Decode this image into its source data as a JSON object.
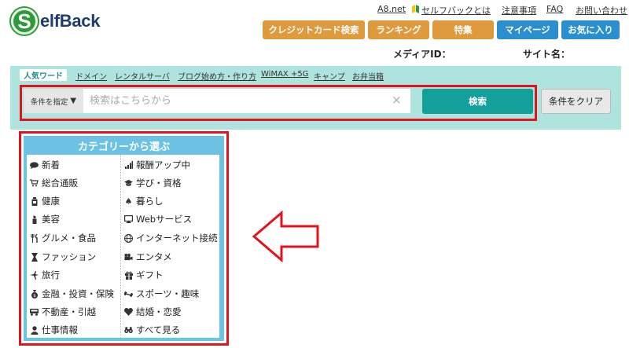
{
  "logo": {
    "mark": "S",
    "text": "elfBack"
  },
  "top_links": [
    {
      "label": "A8.net",
      "icon": ""
    },
    {
      "label": "セルフバックとは",
      "icon": "beginner-leaf-icon"
    },
    {
      "label": "注意事項",
      "icon": ""
    },
    {
      "label": "FAQ",
      "icon": ""
    },
    {
      "label": "お問い合わせ",
      "icon": ""
    }
  ],
  "nav": [
    {
      "label": "クレジットカード検索",
      "color": "#e09a3e"
    },
    {
      "label": "ランキング",
      "color": "#e09a3e"
    },
    {
      "label": "特集",
      "color": "#e09a3e"
    },
    {
      "label": "マイページ",
      "color": "#2b8fcf"
    },
    {
      "label": "お気に入り",
      "color": "#2b8fcf"
    }
  ],
  "meta": {
    "media_id": "メディアID：",
    "site_name": "サイト名："
  },
  "popular": {
    "label": "人気ワード",
    "words": [
      "ドメイン",
      "レンタルサーバ",
      "ブログ始め方・作り方",
      "WiMAX +5G",
      "キャンプ",
      "お弁当箱"
    ]
  },
  "search": {
    "condition": "条件を指定",
    "condition_arrow": "▼",
    "placeholder": "検索はこちらから",
    "clear_x": "×",
    "submit": "検索",
    "clear_conditions": "条件をクリア"
  },
  "categories": {
    "title": "カテゴリーから選ぶ",
    "left": [
      {
        "label": "新着",
        "icon": "speech-bubble-icon"
      },
      {
        "label": "総合通販",
        "icon": "shopping-cart-icon"
      },
      {
        "label": "健康",
        "icon": "medicine-bottle-icon"
      },
      {
        "label": "美容",
        "icon": "lipstick-icon"
      },
      {
        "label": "グルメ・食品",
        "icon": "fork-knife-icon"
      },
      {
        "label": "ファッション",
        "icon": "dress-icon"
      },
      {
        "label": "旅行",
        "icon": "airplane-icon"
      },
      {
        "label": "金融・投資・保険",
        "icon": "money-bag-icon"
      },
      {
        "label": "不動産・引越",
        "icon": "truck-icon"
      },
      {
        "label": "仕事情報",
        "icon": "person-icon"
      }
    ],
    "right": [
      {
        "label": "報酬アップ中",
        "icon": "bar-chart-icon"
      },
      {
        "label": "学び・資格",
        "icon": "graduation-cap-icon"
      },
      {
        "label": "暮らし",
        "icon": "spade-icon"
      },
      {
        "label": "Webサービス",
        "icon": "monitor-icon"
      },
      {
        "label": "インターネット接続",
        "icon": "globe-icon"
      },
      {
        "label": "エンタメ",
        "icon": "video-camera-icon"
      },
      {
        "label": "ギフト",
        "icon": "gift-icon"
      },
      {
        "label": "スポーツ・趣味",
        "icon": "dumbbell-icon"
      },
      {
        "label": "結婚・恋愛",
        "icon": "heart-icon"
      },
      {
        "label": "すべて見る",
        "icon": "binoculars-icon"
      }
    ]
  },
  "colors": {
    "band": "#aee4dd",
    "highlight": "#e0141e",
    "search_button": "#14a09a",
    "category_header": "#6cc2e3"
  }
}
